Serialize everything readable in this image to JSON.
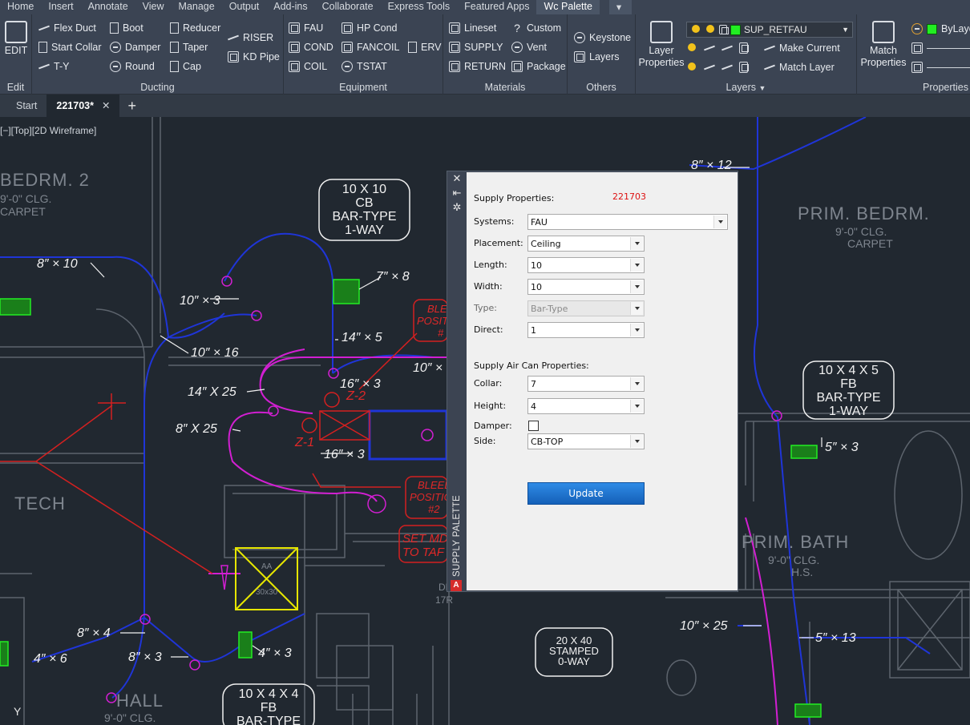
{
  "ribbon_tabs": [
    {
      "label": "Home"
    },
    {
      "label": "Insert"
    },
    {
      "label": "Annotate"
    },
    {
      "label": "View"
    },
    {
      "label": "Manage"
    },
    {
      "label": "Output"
    },
    {
      "label": "Add-ins"
    },
    {
      "label": "Collaborate"
    },
    {
      "label": "Express Tools"
    },
    {
      "label": "Featured Apps"
    },
    {
      "label": "Wc Palette"
    }
  ],
  "panels": {
    "edit": {
      "title": "Edit",
      "button": "EDIT"
    },
    "ducting": {
      "title": "Ducting",
      "items": [
        "Flex Duct",
        "Start Collar",
        "T-Y",
        "Boot",
        "Damper",
        "Round",
        "Reducer",
        "Taper",
        "Cap",
        "RISER",
        "KD Pipe"
      ]
    },
    "equipment": {
      "title": "Equipment",
      "items": [
        "FAU",
        "COND",
        "COIL",
        "HP Cond",
        "FANCOIL",
        "TSTAT",
        "ERV"
      ]
    },
    "materials": {
      "title": "Materials",
      "items": [
        "Lineset",
        "SUPPLY",
        "RETURN",
        "Custom",
        "Vent",
        "Package"
      ]
    },
    "others": {
      "title": "Others",
      "items": [
        "Keystone",
        "Layers"
      ]
    },
    "layers": {
      "title": "Layers",
      "layer_properties": "Layer Properties",
      "current_layer": "SUP_RETFAU",
      "current_layer_color": "#22ee22",
      "make_current": "Make Current",
      "match_layer": "Match Layer"
    },
    "properties": {
      "title": "Properties",
      "match_properties": "Match Properties",
      "color_value": "ByLayer"
    }
  },
  "doc_tabs": {
    "start": "Start",
    "active": "221703*",
    "close": "✕",
    "add": "+"
  },
  "viewport_label": "[−][Top][2D Wireframe]",
  "drawing": {
    "rooms": [
      {
        "name": "BEDRM. 2",
        "ceiling": "9'-0\" CLG.",
        "floor": "CARPET"
      },
      {
        "name": "PRIM. BEDRM.",
        "ceiling": "9'-0\" CLG.",
        "floor": "CARPET"
      },
      {
        "name": "TECH"
      },
      {
        "name": "PRIM. BATH",
        "ceiling": "9'-0\" CLG.",
        "floor": "H.S."
      },
      {
        "name": "HALL",
        "ceiling": "9'-0\" CLG."
      }
    ],
    "dims": [
      "8″ × 10",
      "10″ × 3",
      "7″ × 8",
      "10″ × 16",
      "14″ × 5",
      "10″ ×",
      "14″ X 25",
      "16″ × 3",
      "8″ X 25",
      "16″ × 3",
      "8″ × 4",
      "4″ × 6",
      "8″ × 3",
      "4″ × 3",
      "10″ × 25",
      "5″ × 13",
      "5″ × 3",
      "8″ × 12"
    ],
    "notes": [
      {
        "lines": [
          "10 X 10",
          "CB",
          "BAR-TYPE",
          "1-WAY"
        ]
      },
      {
        "lines": [
          "10 X 4 X 5",
          "FB",
          "BAR-TYPE",
          "1-WAY"
        ]
      },
      {
        "lines": [
          "20 X 40",
          "STAMPED",
          "0-WAY"
        ]
      },
      {
        "lines": [
          "10 X 4 X 4",
          "FB",
          "BAR-TYPE"
        ]
      }
    ],
    "red_labels": [
      "Z-2",
      "Z-1",
      "BLEE",
      "POSITI",
      "#",
      "BLEED",
      "POSITIO",
      "#2",
      "SET MD",
      "TO TAF"
    ],
    "equipment_tags": [
      "AA",
      "30x30"
    ],
    "stair": [
      "DN",
      "17R"
    ],
    "ucs": "Y"
  },
  "palette": {
    "title": "SUPPLY PALETTE",
    "section1": "Supply Properties:",
    "drawing_id": "221703",
    "fields": {
      "systems": {
        "label": "Systems:",
        "value": "FAU"
      },
      "placement": {
        "label": "Placement:",
        "value": "Ceiling"
      },
      "length": {
        "label": "Length:",
        "value": "10"
      },
      "width": {
        "label": "Width:",
        "value": "10"
      },
      "type": {
        "label": "Type:",
        "value": "Bar-Type"
      },
      "direct": {
        "label": "Direct:",
        "value": "1"
      }
    },
    "section2": "Supply Air Can Properties:",
    "can_fields": {
      "collar": {
        "label": "Collar:",
        "value": "7"
      },
      "height": {
        "label": "Height:",
        "value": "4"
      },
      "damper": {
        "label": "Damper:",
        "checked": false
      },
      "side": {
        "label": "Side:",
        "value": "CB-TOP"
      }
    },
    "update_label": "Update",
    "logo": "A"
  }
}
